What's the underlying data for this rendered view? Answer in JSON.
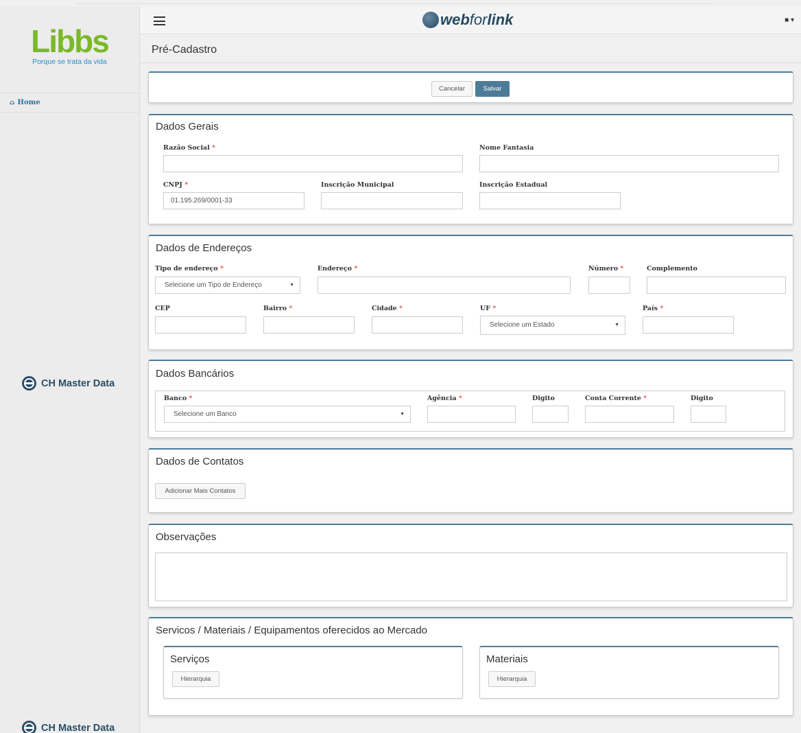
{
  "sidebar": {
    "logo": "Libbs",
    "logo_tagline": "Porque se trata da vida",
    "home_label": "Home",
    "brand_label": "CH Master Data",
    "footer_brand_label": "CH Master Data"
  },
  "header": {
    "logo_bold": "web",
    "logo_light": "for",
    "logo_end": "link",
    "page_title": "Pré-Cadastro"
  },
  "actions": {
    "cancel": "Cancelar",
    "save": "Salvar"
  },
  "dados_gerais": {
    "title": "Dados Gerais",
    "razao_social": "Razão Social",
    "nome_fantasia": "Nome Fantasia",
    "cnpj": "CNPJ",
    "cnpj_value": "01.195.269/0001-33",
    "inscricao_municipal": "Inscrição Municipal",
    "inscricao_estadual": "Inscrição Estadual"
  },
  "enderecos": {
    "title": "Dados de Endereços",
    "tipo": "Tipo de endereço",
    "tipo_placeholder": "Selecione um Tipo de Endereço",
    "endereco": "Endereço",
    "numero": "Número",
    "complemento": "Complemento",
    "cep": "CEP",
    "bairro": "Bairro",
    "cidade": "Cidade",
    "uf": "UF",
    "uf_placeholder": "Selecione um Estado",
    "pais": "País"
  },
  "bancarios": {
    "title": "Dados Bancários",
    "banco": "Banco",
    "banco_placeholder": "Selecione um Banco",
    "agencia": "Agência",
    "digito": "Digito",
    "conta_corrente": "Conta Corrente",
    "digito2": "Digito"
  },
  "contatos": {
    "title": "Dados de Contatos",
    "add_button": "Adicionar Mais Contatos"
  },
  "observacoes": {
    "title": "Observações"
  },
  "servicos_materiais": {
    "title": "Servicos / Materiais / Equipamentos oferecidos ao Mercado",
    "servicos_title": "Serviços",
    "materiais_title": "Materiais",
    "hierarquia": "Hierarquia"
  },
  "colors": {
    "accent": "#4d7c99",
    "required": "#d9534f",
    "logo_green": "#7ab929"
  }
}
